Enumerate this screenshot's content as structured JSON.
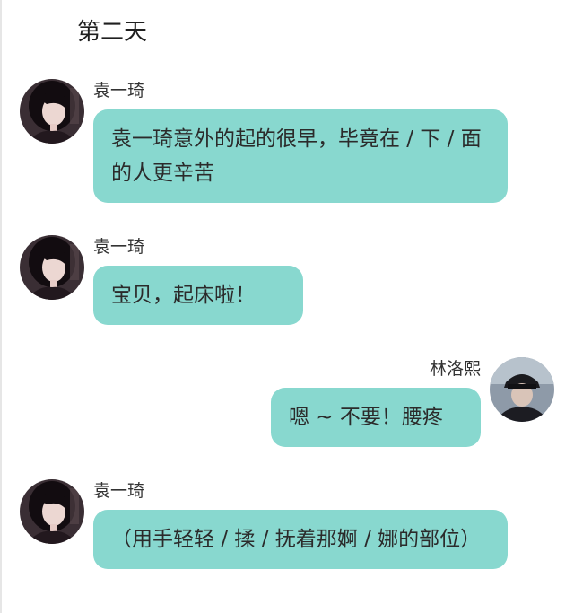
{
  "day_title": "第二天",
  "colors": {
    "bubble": "#88d8cf",
    "background": "#ffffff"
  },
  "messages": [
    {
      "side": "left",
      "sender": "袁一琦",
      "avatar": "female-portrait-avatar",
      "text": "袁一琦意外的起的很早，毕竟在 / 下 / 面的人更辛苦"
    },
    {
      "side": "left",
      "sender": "袁一琦",
      "avatar": "female-portrait-avatar",
      "text": "宝贝，起床啦！"
    },
    {
      "side": "right",
      "sender": "林洛熙",
      "avatar": "hat-portrait-avatar",
      "text": "嗯 ~ 不要！腰疼"
    },
    {
      "side": "left",
      "sender": "袁一琦",
      "avatar": "female-portrait-avatar",
      "text": "（用手轻轻 / 揉 / 抚着那婀 / 娜的部位）"
    }
  ]
}
